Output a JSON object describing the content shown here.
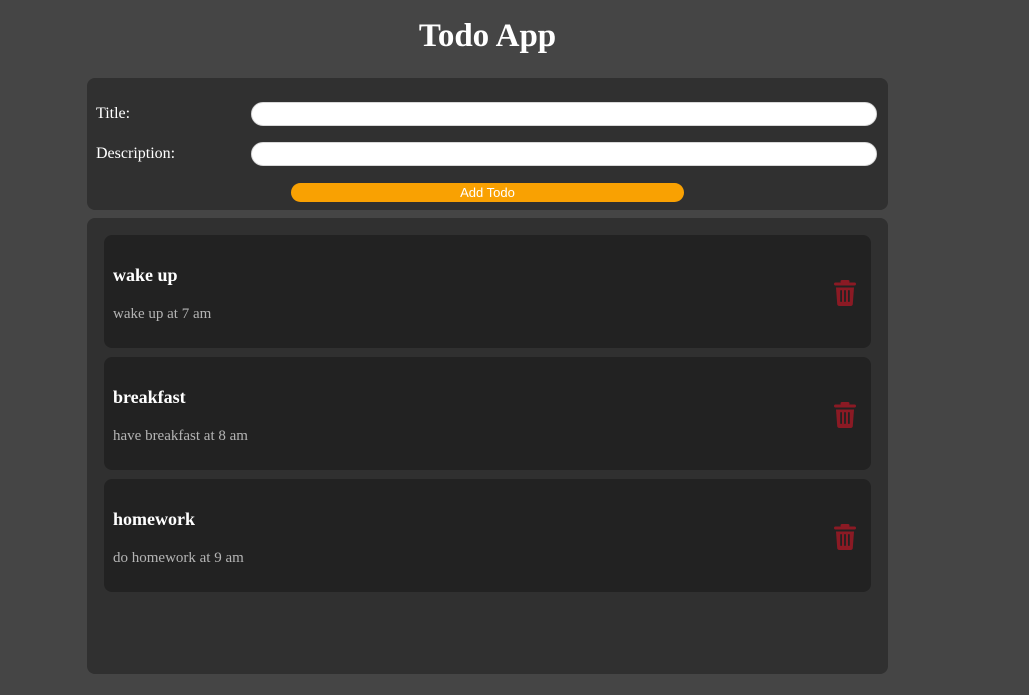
{
  "app": {
    "title": "Todo App"
  },
  "form": {
    "title_label": "Title:",
    "title_value": "",
    "description_label": "Description:",
    "description_value": "",
    "add_button_label": "Add Todo"
  },
  "todos": [
    {
      "title": "wake up",
      "description": "wake up at 7 am"
    },
    {
      "title": "breakfast",
      "description": "have breakfast at 8 am"
    },
    {
      "title": "homework",
      "description": "do homework at 9 am"
    }
  ],
  "colors": {
    "page_background": "#454545",
    "panel_background": "#303030",
    "card_background": "#222222",
    "accent": "#f9a102",
    "delete_icon": "#8b1a24"
  },
  "icons": {
    "delete": "trash-icon"
  }
}
